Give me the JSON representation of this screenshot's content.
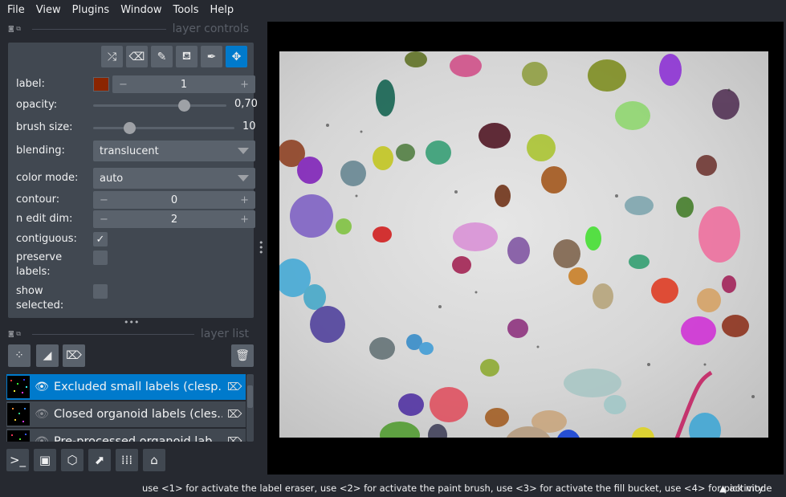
{
  "menubar": {
    "items": [
      "File",
      "View",
      "Plugins",
      "Window",
      "Tools",
      "Help"
    ]
  },
  "layer_controls": {
    "title": "layer controls",
    "toolbar": [
      "shuffle-icon",
      "eraser-icon",
      "brush-icon",
      "fill-icon",
      "picker-icon",
      "pan-icon"
    ],
    "label": {
      "name": "label:",
      "value": "1",
      "color": "#8b2500"
    },
    "opacity": {
      "name": "opacity:",
      "value": 0.7,
      "text": "0,70"
    },
    "brush_size": {
      "name": "brush size:",
      "value": 10,
      "text": "10"
    },
    "blending": {
      "name": "blending:",
      "value": "translucent"
    },
    "color_mode": {
      "name": "color mode:",
      "value": "auto"
    },
    "contour": {
      "name": "contour:",
      "value": "0"
    },
    "n_edit_dim": {
      "name": "n edit dim:",
      "value": "2"
    },
    "contiguous": {
      "name": "contiguous:",
      "checked": true
    },
    "preserve_labels": {
      "name": "preserve labels:",
      "checked": false
    },
    "show_selected": {
      "name": "show selected:",
      "checked": false
    }
  },
  "layer_list": {
    "title": "layer list",
    "layers": [
      {
        "name": "Excluded small labels (clesperanto)",
        "display": "Excluded small labels (clesp...",
        "selected": true,
        "visible": true
      },
      {
        "name": "Closed organoid labels (clesperanto)",
        "display": "Closed organoid labels (cles...",
        "selected": false,
        "visible": false
      },
      {
        "name": "Pre-processed organoid labels",
        "display": "Pre-processed organoid lab...",
        "selected": false,
        "visible": false
      }
    ]
  },
  "status": {
    "message": "use <1> for activate the label eraser, use <2> for activate the paint brush, use <3> for activate the fill bucket, use <4> for pick mode",
    "activity": "activity"
  },
  "colors": {
    "accent": "#007acc",
    "panel": "#414851",
    "background": "#262930"
  }
}
